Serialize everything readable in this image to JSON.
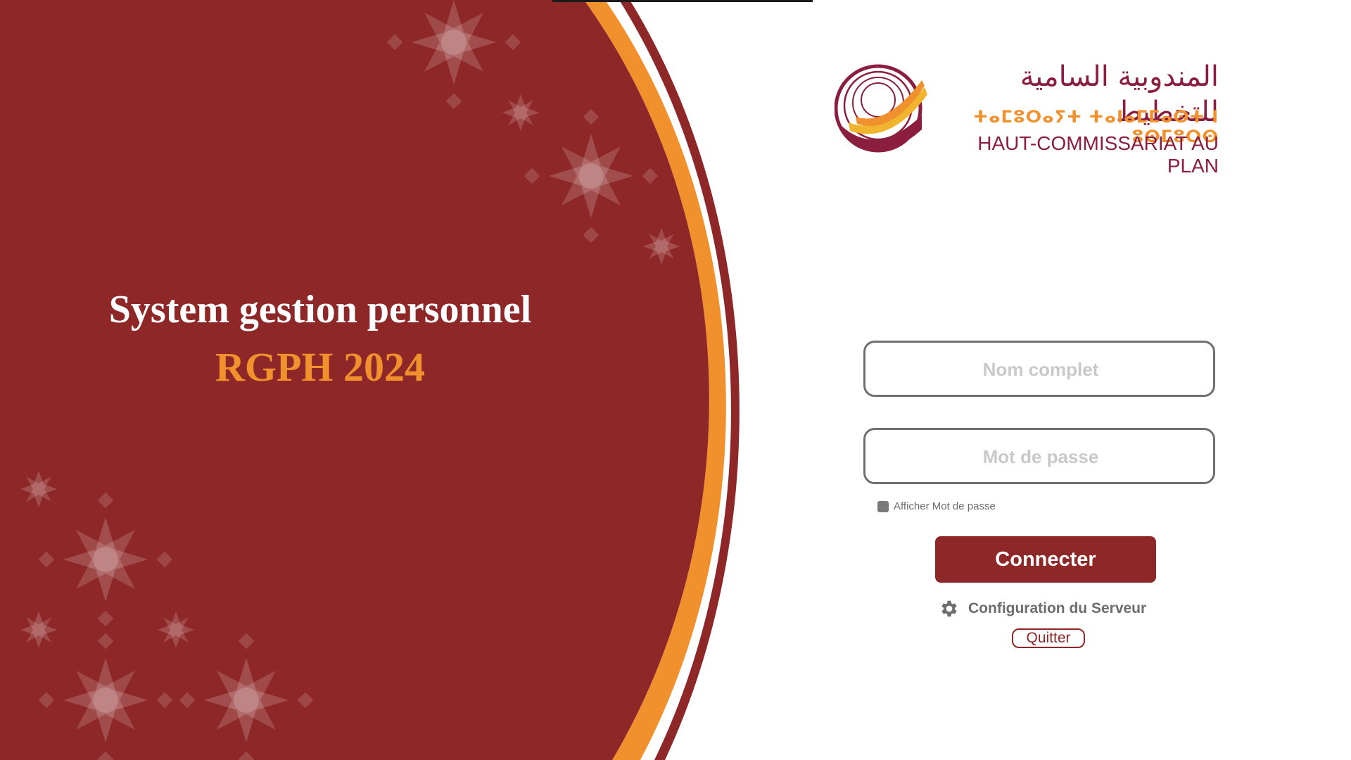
{
  "app": {
    "title_main": "System gestion personnel",
    "title_sub": "RGPH 2024"
  },
  "logo": {
    "arabic": "المندوبية السامية للتخطيط",
    "tifinagh": "ⵜⴰⵎⵓⵔⴰⵢⵜ ⵜⴰⵏⴰⵎⵎⴰⵙⵜ ⵏ ⵓⵙⵎⵓⵔⵙ",
    "french": "HAUT-COMMISSARIAT AU PLAN"
  },
  "login": {
    "username_placeholder": "Nom complet",
    "password_placeholder": "Mot de passe",
    "show_password_label": "Afficher Mot de passe",
    "connect_label": "Connecter",
    "server_config_label": "Configuration du Serveur",
    "quit_label": "Quitter"
  },
  "icons": {
    "settings": "gear-icon",
    "logo_emblem": "hcp-emblem-icon"
  },
  "colors": {
    "primary_red": "#8e2727",
    "accent_orange": "#f0912e",
    "brand_burgundy": "#8b1e3f"
  }
}
